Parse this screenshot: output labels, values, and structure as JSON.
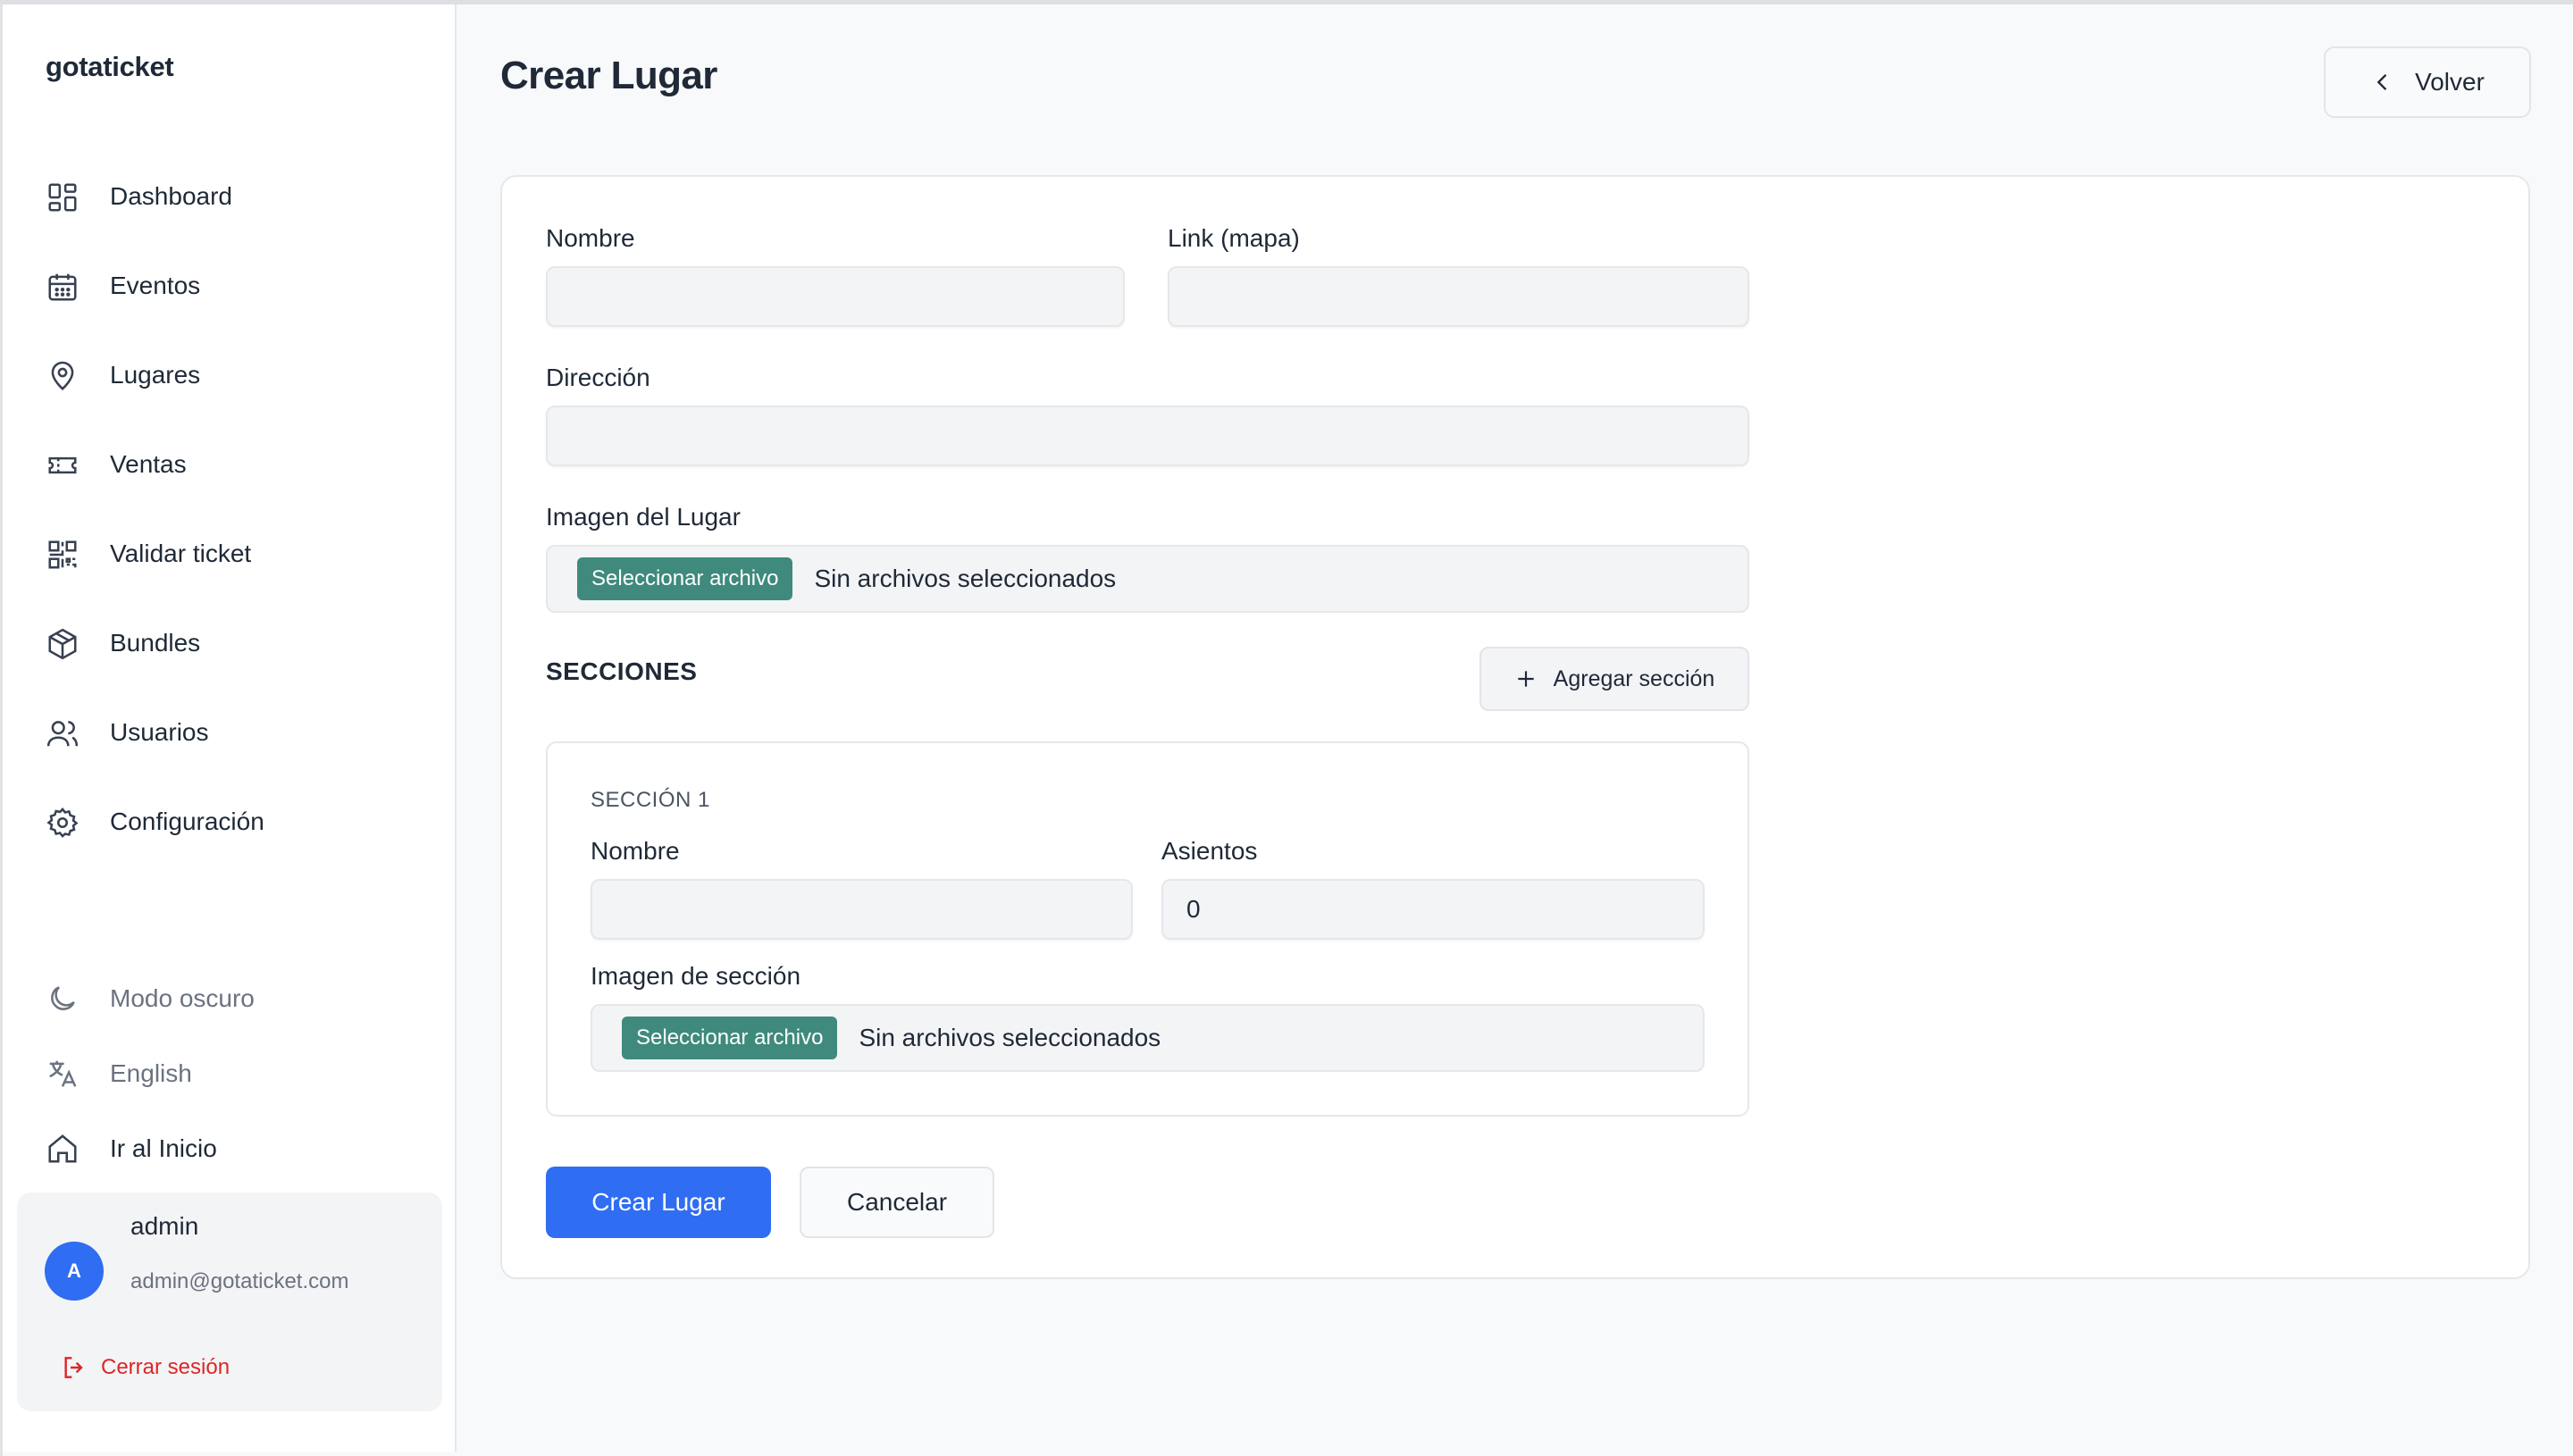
{
  "app": {
    "brand": "gotaticket"
  },
  "sidebar": {
    "items": [
      {
        "label": "Dashboard",
        "icon": "dashboard-icon"
      },
      {
        "label": "Eventos",
        "icon": "calendar-icon"
      },
      {
        "label": "Lugares",
        "icon": "map-pin-icon"
      },
      {
        "label": "Ventas",
        "icon": "ticket-icon"
      },
      {
        "label": "Validar ticket",
        "icon": "qr-code-icon"
      },
      {
        "label": "Bundles",
        "icon": "package-icon"
      },
      {
        "label": "Usuarios",
        "icon": "users-icon"
      },
      {
        "label": "Configuración",
        "icon": "settings-icon"
      }
    ],
    "utilities": {
      "dark_mode": "Modo oscuro",
      "language": "English",
      "home": "Ir al Inicio"
    },
    "user": {
      "initial": "A",
      "name": "admin",
      "email": "admin@gotaticket.com",
      "logout": "Cerrar sesión"
    }
  },
  "header": {
    "title": "Crear Lugar",
    "back_label": "Volver"
  },
  "form": {
    "name_label": "Nombre",
    "name_value": "",
    "link_label": "Link (mapa)",
    "link_value": "",
    "address_label": "Dirección",
    "address_value": "",
    "image_label": "Imagen del Lugar",
    "file_button": "Seleccionar archivo",
    "file_status": "Sin archivos seleccionados",
    "sections_heading": "SECCIONES",
    "add_section": "Agregar sección",
    "section": {
      "title": "SECCIÓN 1",
      "name_label": "Nombre",
      "name_value": "",
      "seats_label": "Asientos",
      "seats_value": "0",
      "image_label": "Imagen de sección",
      "file_button": "Seleccionar archivo",
      "file_status": "Sin archivos seleccionados"
    },
    "submit": "Crear Lugar",
    "cancel": "Cancelar"
  },
  "colors": {
    "primary": "#2f6df2",
    "file_button": "#3f8a7d",
    "danger": "#dc2626"
  }
}
